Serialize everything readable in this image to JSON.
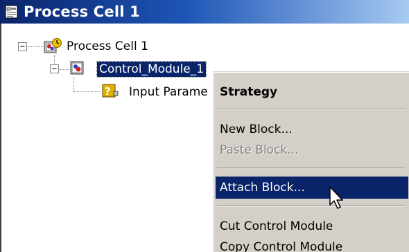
{
  "window": {
    "title": "Process Cell 1",
    "title_icon": "explorer-window-icon"
  },
  "tree": {
    "root": {
      "label": "Process Cell 1",
      "icon": "process-cell-icon",
      "expander": "−"
    },
    "module": {
      "label": "Control_Module_1",
      "icon": "control-module-icon",
      "expander": "−",
      "selected": true
    },
    "param": {
      "label": "Input Parame",
      "icon": "input-parameter-icon"
    }
  },
  "context_menu": {
    "header": "Strategy",
    "items": [
      {
        "label": "New Block...",
        "state": "enabled"
      },
      {
        "label": "Paste Block...",
        "state": "disabled"
      },
      {
        "label": "Attach Block...",
        "state": "highlighted"
      },
      {
        "label": "Cut Control Module",
        "state": "enabled"
      },
      {
        "label": "Copy Control Module",
        "state": "enabled"
      }
    ]
  },
  "colors": {
    "selection": "#0a246a",
    "menu_bg": "#d4d0c8",
    "title_start": "#0a246a",
    "title_end": "#a6caf0"
  },
  "cursor": "arrow-cursor-icon"
}
